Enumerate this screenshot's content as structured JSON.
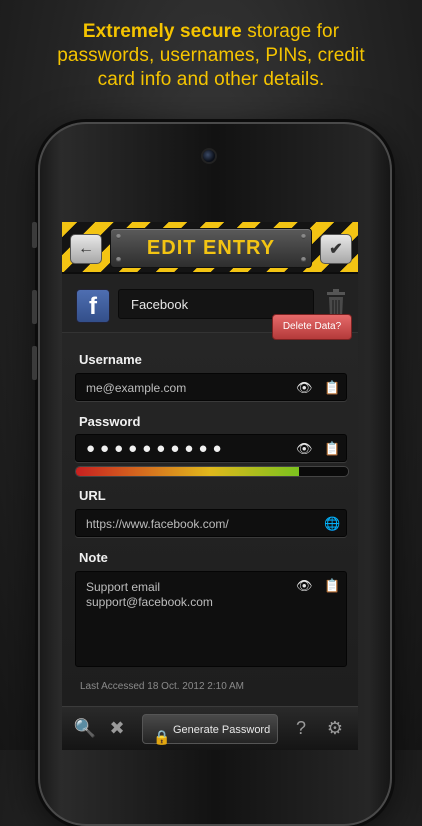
{
  "promo": {
    "bold": "Extremely secure",
    "line1_rest": " storage for",
    "line2": "passwords, usernames, PINs, credit",
    "line3": "card info and other details."
  },
  "header": {
    "title": "EDIT ENTRY",
    "back_icon": "back-arrow-icon",
    "save_icon": "checkmark-icon"
  },
  "entry": {
    "name": "Facebook",
    "icon": "facebook-icon",
    "delete_label": "Delete Data?"
  },
  "fields": {
    "username_label": "Username",
    "username_value": "me@example.com",
    "password_label": "Password",
    "password_value": "●●●●●●●●●●",
    "password_strength": 0.82,
    "url_label": "URL",
    "url_value": "https://www.facebook.com/",
    "note_label": "Note",
    "note_line1": "Support email",
    "note_line2": "support@facebook.com"
  },
  "footer": {
    "last_accessed": "Last Accessed 18 Oct. 2012 2:10 AM",
    "generate_label": "Generate Password"
  },
  "colors": {
    "accent": "#f3c413",
    "delete": "#c94a4a",
    "facebook": "#3b5998"
  }
}
